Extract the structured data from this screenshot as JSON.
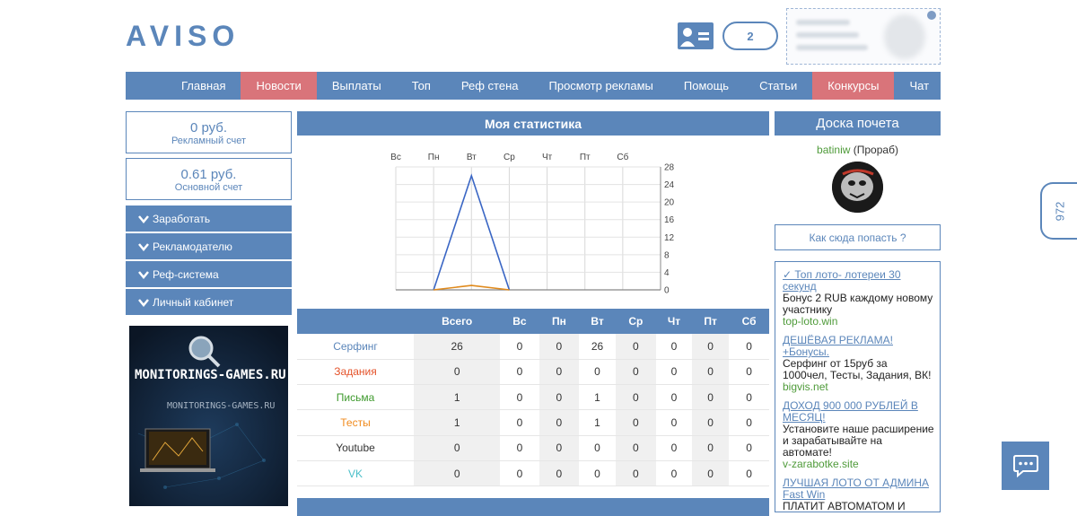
{
  "header": {
    "logo": "AVISO",
    "notifications_count": "2"
  },
  "nav": {
    "items": [
      {
        "label": "Главная",
        "active": false
      },
      {
        "label": "Новости",
        "active": true
      },
      {
        "label": "Выплаты",
        "active": false
      },
      {
        "label": "Топ",
        "active": false
      },
      {
        "label": "Реф стена",
        "active": false
      },
      {
        "label": "Просмотр рекламы",
        "active": false
      },
      {
        "label": "Помощь",
        "active": false
      },
      {
        "label": "Статьи",
        "active": false
      },
      {
        "label": "Конкурсы",
        "active": true
      },
      {
        "label": "Чат",
        "active": false
      }
    ]
  },
  "balances": [
    {
      "value": "0 руб.",
      "label": "Рекламный счет"
    },
    {
      "value": "0.61 руб.",
      "label": "Основной счет"
    }
  ],
  "menu": [
    "Заработать",
    "Рекламодателю",
    "Реф-система",
    "Личный кабинет"
  ],
  "banner": {
    "title": "MONITORINGS-GAMES.RU",
    "subtitle": "MONITORINGS-GAMES.RU"
  },
  "stats": {
    "title": "Моя статистика",
    "columns": [
      "",
      "Всего",
      "Вс",
      "Пн",
      "Вт",
      "Ср",
      "Чт",
      "Пт",
      "Сб"
    ],
    "rows": [
      {
        "label": "Серфинг",
        "color": "#5b86ba",
        "values": [
          "26",
          "0",
          "0",
          "26",
          "0",
          "0",
          "0",
          "0"
        ]
      },
      {
        "label": "Задания",
        "color": "#e4532b",
        "values": [
          "0",
          "0",
          "0",
          "0",
          "0",
          "0",
          "0",
          "0"
        ]
      },
      {
        "label": "Письма",
        "color": "#3f9a2e",
        "values": [
          "1",
          "0",
          "0",
          "1",
          "0",
          "0",
          "0",
          "0"
        ]
      },
      {
        "label": "Тесты",
        "color": "#f08a1c",
        "values": [
          "1",
          "0",
          "0",
          "1",
          "0",
          "0",
          "0",
          "0"
        ]
      },
      {
        "label": "Youtube",
        "color": "#333333",
        "values": [
          "0",
          "0",
          "0",
          "0",
          "0",
          "0",
          "0",
          "0"
        ]
      },
      {
        "label": "VK",
        "color": "#4bbfc9",
        "values": [
          "0",
          "0",
          "0",
          "0",
          "0",
          "0",
          "0",
          "0"
        ]
      }
    ]
  },
  "chart_data": {
    "type": "line",
    "categories": [
      "Вс",
      "Пн",
      "Вт",
      "Ср",
      "Чт",
      "Пт",
      "Сб"
    ],
    "ylim": [
      0,
      28
    ],
    "yticks": [
      0,
      4,
      8,
      12,
      16,
      20,
      24,
      28
    ],
    "grid": true,
    "series": [
      {
        "color": "#3a66c4",
        "values": [
          0,
          0,
          26,
          0,
          0,
          0,
          0
        ]
      },
      {
        "color": "#e08a1c",
        "values": [
          0,
          0,
          1,
          0,
          0,
          0,
          0
        ]
      }
    ]
  },
  "honor": {
    "title": "Доска почета",
    "user": "batiniw",
    "rank": "(Прораб)",
    "how_label": "Как сюда попасть ?"
  },
  "ads": [
    {
      "title": "✓ Топ лото- лотереи 30 секунд",
      "desc": "Бонус 2 RUB каждому новому участнику",
      "url": "top-loto.win"
    },
    {
      "title": "ДЕШЁВАЯ РЕКЛАМА! +Бонусы.",
      "desc": "Серфинг от 15руб за 1000чел, Тесты, Задания, ВК!",
      "url": "bigvis.net"
    },
    {
      "title": "ДОХОД 900 000 РУБЛЕЙ В МЕСЯЦ!",
      "desc": "Установите наше расширение и зарабатывайте на автомате!",
      "url": "v-zarabotke.site"
    },
    {
      "title": "ЛУЧШАЯ ЛОТО ОТ АДМИНА Fast Win",
      "desc": "ПЛАТИТ АВТОМАТОМ И",
      "url": ""
    }
  ],
  "side_tab": "972"
}
